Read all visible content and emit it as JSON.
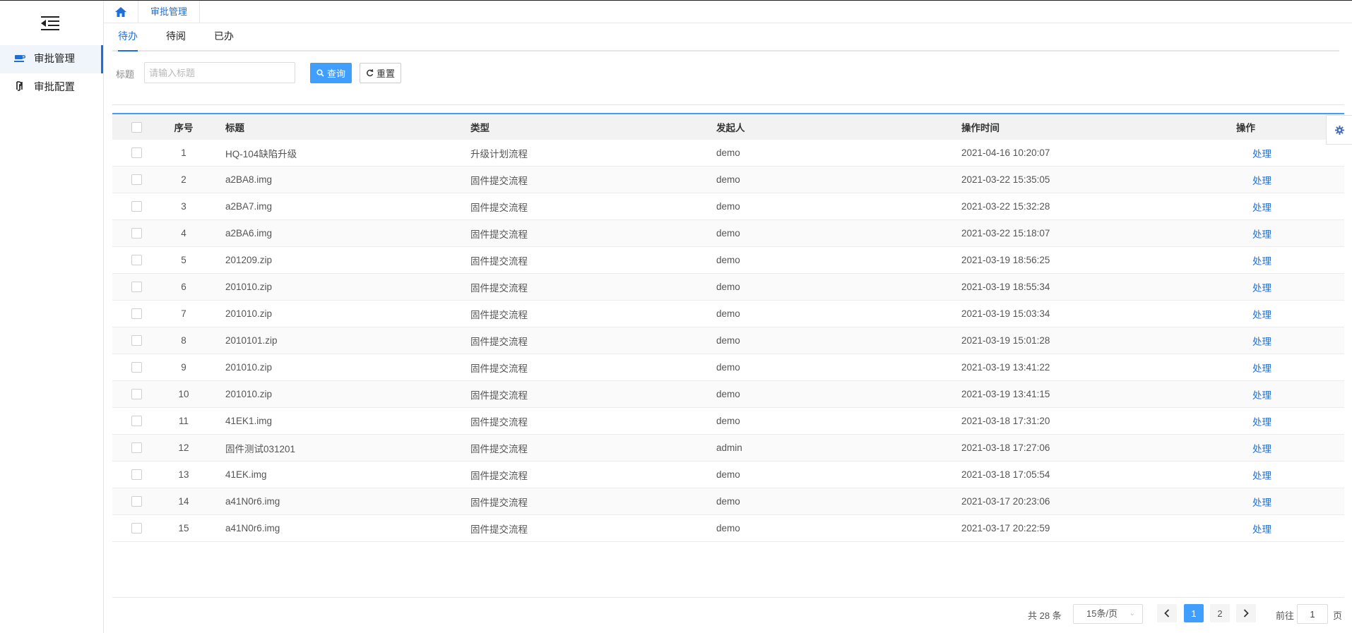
{
  "sidebar": {
    "items": [
      {
        "label": "审批管理",
        "icon": "cup-icon",
        "active": true
      },
      {
        "label": "审批配置",
        "icon": "flow-icon",
        "active": false
      }
    ]
  },
  "breadcrumb": {
    "page_tab": "审批管理"
  },
  "tabs": [
    {
      "label": "待办",
      "active": true
    },
    {
      "label": "待阅",
      "active": false
    },
    {
      "label": "已办",
      "active": false
    }
  ],
  "search": {
    "label": "标题",
    "placeholder": "请输入标题",
    "value": "",
    "query_label": "查询",
    "reset_label": "重置"
  },
  "table": {
    "columns": {
      "no": "序号",
      "title": "标题",
      "type": "类型",
      "initiator": "发起人",
      "time": "操作时间",
      "action": "操作"
    },
    "rows": [
      {
        "no": "1",
        "title": "HQ-104缺陷升级",
        "type": "升级计划流程",
        "initiator": "demo",
        "time": "2021-04-16 10:20:07",
        "action": "处理"
      },
      {
        "no": "2",
        "title": "a2BA8.img",
        "type": "固件提交流程",
        "initiator": "demo",
        "time": "2021-03-22 15:35:05",
        "action": "处理"
      },
      {
        "no": "3",
        "title": "a2BA7.img",
        "type": "固件提交流程",
        "initiator": "demo",
        "time": "2021-03-22 15:32:28",
        "action": "处理"
      },
      {
        "no": "4",
        "title": "a2BA6.img",
        "type": "固件提交流程",
        "initiator": "demo",
        "time": "2021-03-22 15:18:07",
        "action": "处理"
      },
      {
        "no": "5",
        "title": "201209.zip",
        "type": "固件提交流程",
        "initiator": "demo",
        "time": "2021-03-19 18:56:25",
        "action": "处理"
      },
      {
        "no": "6",
        "title": "201010.zip",
        "type": "固件提交流程",
        "initiator": "demo",
        "time": "2021-03-19 18:55:34",
        "action": "处理"
      },
      {
        "no": "7",
        "title": "201010.zip",
        "type": "固件提交流程",
        "initiator": "demo",
        "time": "2021-03-19 15:03:34",
        "action": "处理"
      },
      {
        "no": "8",
        "title": "2010101.zip",
        "type": "固件提交流程",
        "initiator": "demo",
        "time": "2021-03-19 15:01:28",
        "action": "处理"
      },
      {
        "no": "9",
        "title": "201010.zip",
        "type": "固件提交流程",
        "initiator": "demo",
        "time": "2021-03-19 13:41:22",
        "action": "处理"
      },
      {
        "no": "10",
        "title": "201010.zip",
        "type": "固件提交流程",
        "initiator": "demo",
        "time": "2021-03-19 13:41:15",
        "action": "处理"
      },
      {
        "no": "11",
        "title": "41EK1.img",
        "type": "固件提交流程",
        "initiator": "demo",
        "time": "2021-03-18 17:31:20",
        "action": "处理"
      },
      {
        "no": "12",
        "title": "固件测试031201",
        "type": "固件提交流程",
        "initiator": "admin",
        "time": "2021-03-18 17:27:06",
        "action": "处理"
      },
      {
        "no": "13",
        "title": "41EK.img",
        "type": "固件提交流程",
        "initiator": "demo",
        "time": "2021-03-18 17:05:54",
        "action": "处理"
      },
      {
        "no": "14",
        "title": "a41N0r6.img",
        "type": "固件提交流程",
        "initiator": "demo",
        "time": "2021-03-17 20:23:06",
        "action": "处理"
      },
      {
        "no": "15",
        "title": "a41N0r6.img",
        "type": "固件提交流程",
        "initiator": "demo",
        "time": "2021-03-17 20:22:59",
        "action": "处理"
      }
    ]
  },
  "pagination": {
    "total": "共 28 条",
    "page_size": "15条/页",
    "pages": [
      "1",
      "2"
    ],
    "current_page": "1",
    "goto_prefix": "前往",
    "goto_value": "1",
    "goto_suffix": "页"
  },
  "colors": {
    "accent": "#409eff",
    "link": "#1e6fd9"
  }
}
